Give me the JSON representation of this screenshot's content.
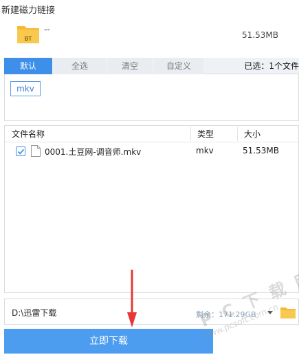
{
  "window": {
    "title": "新建磁力链接"
  },
  "torrent": {
    "icon_label": "BT",
    "name": "--",
    "total_size": "51.53MB"
  },
  "tabs": [
    {
      "label": "默认",
      "active": true
    },
    {
      "label": "全选",
      "active": false
    },
    {
      "label": "清空",
      "active": false
    },
    {
      "label": "自定义",
      "active": false
    }
  ],
  "selection": {
    "text": "已选：1个文件"
  },
  "filters": {
    "ext_tag": "mkv"
  },
  "table": {
    "headers": {
      "name": "文件名称",
      "type": "类型",
      "size": "大小"
    },
    "rows": [
      {
        "checked": true,
        "name": "0001.土豆网-调音师.mkv",
        "type": "mkv",
        "size": "51.53MB"
      }
    ]
  },
  "save": {
    "path": "D:\\迅雷下载",
    "free_space": "剩余：171.29GB"
  },
  "download_button": {
    "label": "立即下载"
  },
  "watermark": {
    "big": "P C 下 载 网",
    "small": "www.pcsoft.com.cn"
  },
  "colors": {
    "accent": "#3d8fea",
    "button": "#4c9cf0",
    "folder": "#f5b93a",
    "arrow": "#e53935"
  }
}
